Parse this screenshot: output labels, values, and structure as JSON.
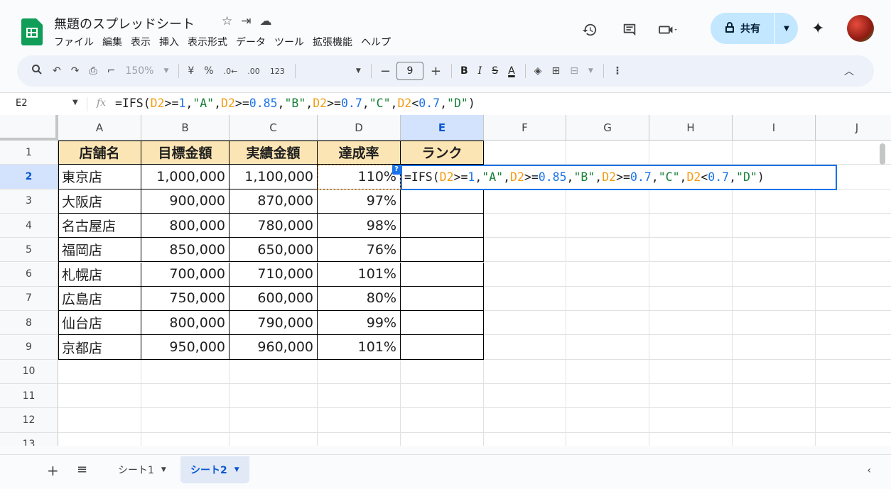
{
  "doc": {
    "title": "無題のスプレッドシート",
    "title_icons": [
      "☆",
      "⇥",
      "☁"
    ]
  },
  "menu": [
    "ファイル",
    "編集",
    "表示",
    "挿入",
    "表示形式",
    "データ",
    "ツール",
    "拡張機能",
    "ヘルプ"
  ],
  "header": {
    "share_label": "共有",
    "icons": [
      "history-icon",
      "comment-icon",
      "meet-icon"
    ]
  },
  "toolbar": {
    "zoom": "150%",
    "currency": "¥",
    "percent": "%",
    "dec_decrease": ".0←",
    "dec_increase": ".00",
    "number_format": "123",
    "font_size": "9",
    "bold": "B",
    "italic": "I",
    "strike": "S",
    "text_color": "A"
  },
  "formula_bar": {
    "name_box": "E2",
    "fx": "fx",
    "tokens": [
      {
        "t": "=IFS(",
        "c": "fo-tok"
      },
      {
        "t": "D2",
        "c": "ref"
      },
      {
        "t": ">=",
        "c": "fo-tok"
      },
      {
        "t": "1",
        "c": "num"
      },
      {
        "t": ",",
        "c": "fo-tok"
      },
      {
        "t": "\"A\"",
        "c": "str"
      },
      {
        "t": ",",
        "c": "fo-tok"
      },
      {
        "t": "D2",
        "c": "ref"
      },
      {
        "t": ">=",
        "c": "fo-tok"
      },
      {
        "t": "0.85",
        "c": "num"
      },
      {
        "t": ",",
        "c": "fo-tok"
      },
      {
        "t": "\"B\"",
        "c": "str"
      },
      {
        "t": ",",
        "c": "fo-tok"
      },
      {
        "t": "D2",
        "c": "ref"
      },
      {
        "t": ">=",
        "c": "fo-tok"
      },
      {
        "t": "0.7",
        "c": "num"
      },
      {
        "t": ",",
        "c": "fo-tok"
      },
      {
        "t": "\"C\"",
        "c": "str"
      },
      {
        "t": ",",
        "c": "fo-tok"
      },
      {
        "t": "D2",
        "c": "ref"
      },
      {
        "t": "<",
        "c": "fo-tok"
      },
      {
        "t": "0.7",
        "c": "num"
      },
      {
        "t": ",",
        "c": "fo-tok"
      },
      {
        "t": "\"D\"",
        "c": "str"
      },
      {
        "t": ")",
        "c": "fo-tok"
      }
    ]
  },
  "columns": [
    "A",
    "B",
    "C",
    "D",
    "E",
    "F",
    "G",
    "H",
    "I",
    "J"
  ],
  "selected_col": "E",
  "selected_row": 2,
  "rows": [
    "1",
    "2",
    "3",
    "4",
    "5",
    "6",
    "7",
    "8",
    "9",
    "10",
    "11",
    "12",
    "13"
  ],
  "table": {
    "headers": [
      "店舗名",
      "目標金額",
      "実績金額",
      "達成率",
      "ランク"
    ],
    "data": [
      [
        "東京店",
        "1,000,000",
        "1,100,000",
        "110%",
        ""
      ],
      [
        "大阪店",
        "900,000",
        "870,000",
        "97%",
        ""
      ],
      [
        "名古屋店",
        "800,000",
        "780,000",
        "98%",
        ""
      ],
      [
        "福岡店",
        "850,000",
        "650,000",
        "76%",
        ""
      ],
      [
        "札幌店",
        "700,000",
        "710,000",
        "101%",
        ""
      ],
      [
        "広島店",
        "750,000",
        "600,000",
        "80%",
        ""
      ],
      [
        "仙台店",
        "800,000",
        "790,000",
        "99%",
        ""
      ],
      [
        "京都店",
        "950,000",
        "960,000",
        "101%",
        ""
      ]
    ]
  },
  "sheets": [
    {
      "name": "シート1",
      "active": false
    },
    {
      "name": "シート2",
      "active": true
    }
  ],
  "colors": {
    "header_fill": "#fce5b4",
    "selection": "#1a73e8",
    "share_bg": "#c2e7ff"
  }
}
